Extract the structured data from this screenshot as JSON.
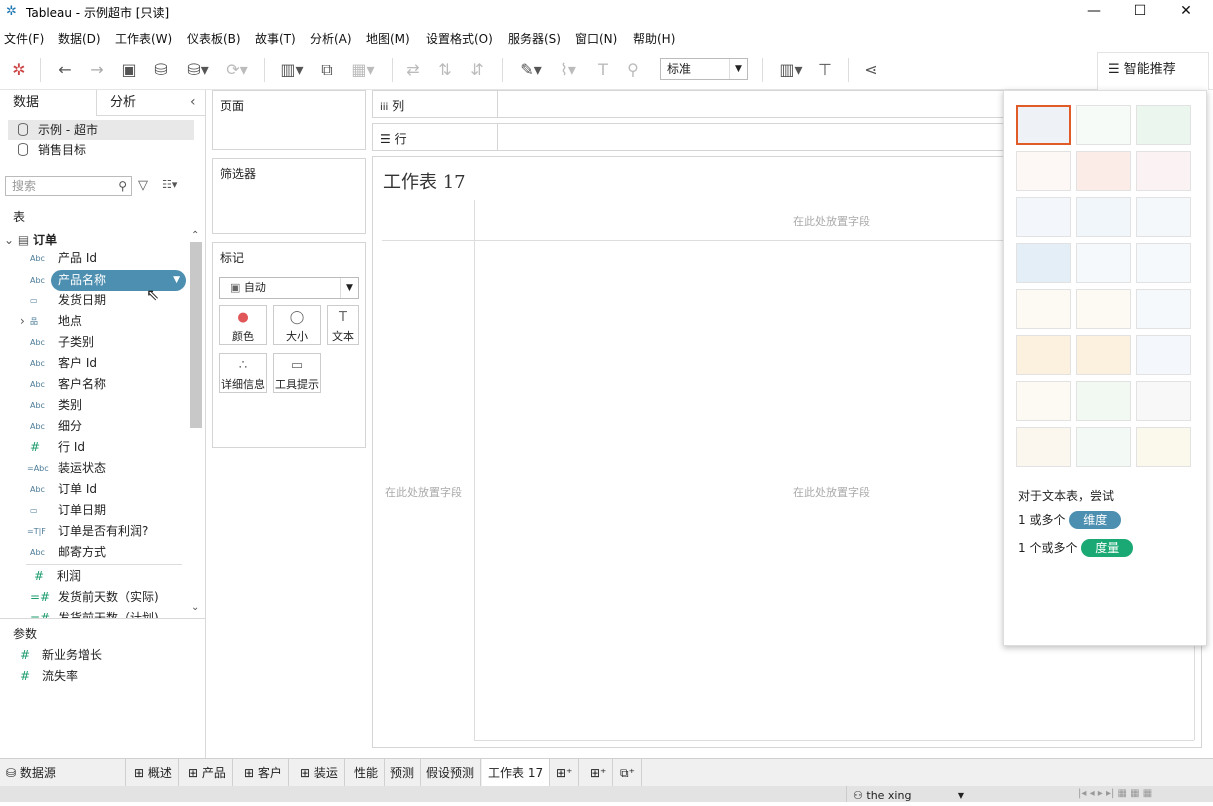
{
  "window": {
    "title": "Tableau - 示例超市 [只读]",
    "minimize": "—",
    "maximize": "☐",
    "close": "✕"
  },
  "menu": [
    "文件(F)",
    "数据(D)",
    "工作表(W)",
    "仪表板(B)",
    "故事(T)",
    "分析(A)",
    "地图(M)",
    "设置格式(O)",
    "服务器(S)",
    "窗口(N)",
    "帮助(H)"
  ],
  "toolbar": {
    "zoom": "标准",
    "smart_label": "智能推荐"
  },
  "left": {
    "tab_data": "数据",
    "tab_analysis": "分析",
    "sources": [
      "示例 - 超市",
      "销售目标"
    ],
    "search_placeholder": "搜索",
    "section_tables": "表",
    "table_name": "订单",
    "fields": [
      {
        "icon": "Abc",
        "name": "产品 Id"
      },
      {
        "icon": "Abc",
        "name": "产品名称"
      },
      {
        "icon": "▭",
        "name": "发货日期"
      },
      {
        "icon": "品",
        "name": "地点"
      },
      {
        "icon": "Abc",
        "name": "子类别"
      },
      {
        "icon": "Abc",
        "name": "客户 Id"
      },
      {
        "icon": "Abc",
        "name": "客户名称"
      },
      {
        "icon": "Abc",
        "name": "类别"
      },
      {
        "icon": "Abc",
        "name": "细分"
      },
      {
        "icon": "#",
        "name": "行 Id"
      },
      {
        "icon": "=Abc",
        "name": "装运状态"
      },
      {
        "icon": "Abc",
        "name": "订单 Id"
      },
      {
        "icon": "▭",
        "name": "订单日期"
      },
      {
        "icon": "=T|F",
        "name": "订单是否有利润?"
      },
      {
        "icon": "Abc",
        "name": "邮寄方式"
      }
    ],
    "measures": [
      {
        "icon": "#",
        "name": "利润"
      },
      {
        "icon": "=#",
        "name": "发货前天数（实际)"
      },
      {
        "icon": "=#",
        "name": "发货前天数（计划)"
      }
    ],
    "section_params": "参数",
    "params": [
      "新业务增长",
      "流失率"
    ]
  },
  "shelves": {
    "pages": "页面",
    "filters": "筛选器",
    "marks": "标记",
    "mark_type": "自动",
    "columns": "列",
    "rows": "行"
  },
  "mark_buttons": [
    {
      "icon": "●",
      "label": "颜色"
    },
    {
      "icon": "◯",
      "label": "大小"
    },
    {
      "icon": "T",
      "label": "文本"
    },
    {
      "icon": "∴",
      "label": "详细信息"
    },
    {
      "icon": "▭",
      "label": "工具提示"
    }
  ],
  "sheet": {
    "title": "工作表 17",
    "drop_text": "在此处放置字段"
  },
  "smart": {
    "hint": "对于文本表，尝试",
    "dims_prefix": "1 或多个",
    "dims_pill": "维度",
    "meas_prefix": "1 个或多个",
    "meas_pill": "度量"
  },
  "colors": {
    "dim": "#4d8fb0",
    "meas": "#1aa874",
    "selected_border": "#e15b29"
  },
  "bottom_tabs": [
    "数据源",
    "概述",
    "产品",
    "客户",
    "装运",
    "性能",
    "预测",
    "假设预测",
    "工作表 17"
  ],
  "status": {
    "user": "the xing"
  }
}
